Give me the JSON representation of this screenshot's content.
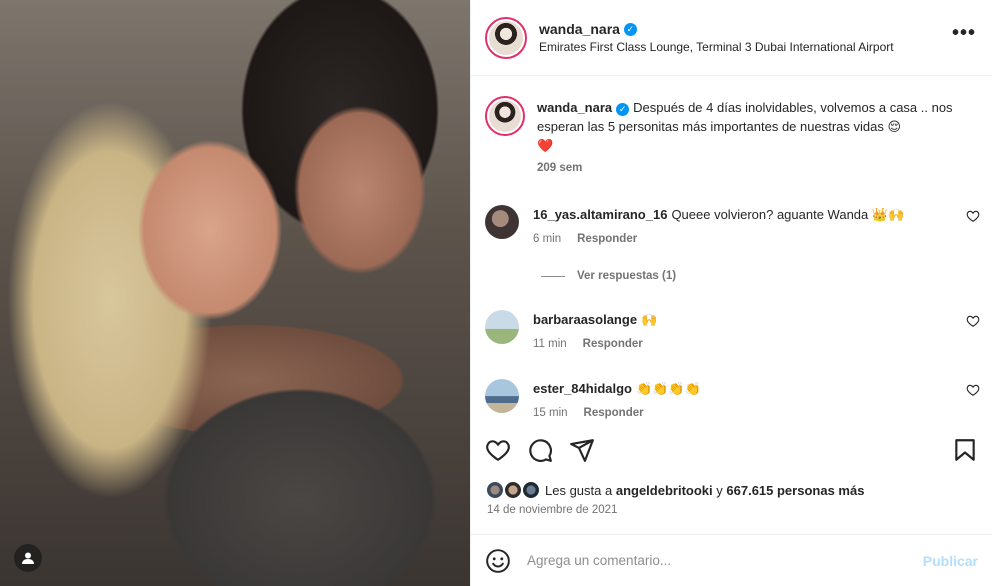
{
  "post": {
    "username": "wanda_nara",
    "location": "Emirates First Class Lounge, Terminal 3 Dubai International Airport",
    "more_label": "•••"
  },
  "caption": {
    "username": "wanda_nara",
    "text": "Después de 4 días inolvidables, volvemos a casa .. nos esperan las 5 personitas más importantes de nuestras vidas 😌",
    "heart": "❤️",
    "time": "209 sem"
  },
  "comments": [
    {
      "username": "16_yas.altamirano_16",
      "text": "Queee volvieron? aguante Wanda 👑🙌",
      "time": "6 min",
      "reply": "Responder"
    },
    {
      "username": "barbaraasolange",
      "text": "🙌",
      "time": "11 min",
      "reply": "Responder"
    },
    {
      "username": "ester_84hidalgo",
      "text": "👏👏👏👏",
      "time": "15 min",
      "reply": "Responder"
    }
  ],
  "view_replies": "Ver respuestas (1)",
  "likes": {
    "prefix": "Les gusta a",
    "user": "angeldebritooki",
    "middle": "y",
    "count": "667.615 personas más"
  },
  "date": "14 de noviembre de 2021",
  "composer": {
    "placeholder": "Agrega un comentario...",
    "publish": "Publicar"
  },
  "colors": {
    "accent": "#0095f6",
    "publish_disabled": "#b2dffc",
    "heart": "#ed4956"
  },
  "icons": [
    "like-icon",
    "comment-icon",
    "share-icon",
    "save-icon",
    "emoji-icon",
    "verified-icon",
    "more-icon",
    "user-tag-icon"
  ]
}
